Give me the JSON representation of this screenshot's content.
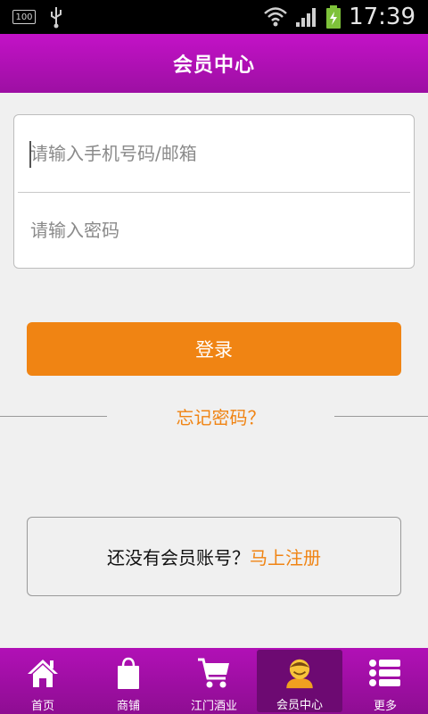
{
  "status_bar": {
    "battery_small_label": "100",
    "time": "17:39"
  },
  "header": {
    "title": "会员中心"
  },
  "login_form": {
    "username_placeholder": "请输入手机号码/邮箱",
    "password_placeholder": "请输入密码",
    "login_label": "登录",
    "forgot_label": "忘记密码？"
  },
  "register": {
    "prompt": "还没有会员账号？",
    "link": "马上注册"
  },
  "bottom_nav": {
    "items": [
      {
        "label": "首页",
        "icon": "home-icon"
      },
      {
        "label": "商铺",
        "icon": "shopping-bag-icon"
      },
      {
        "label": "江门酒业",
        "icon": "cart-icon"
      },
      {
        "label": "会员中心",
        "icon": "member-icon",
        "active": true
      },
      {
        "label": "更多",
        "icon": "more-list-icon"
      }
    ]
  },
  "colors": {
    "brand_purple": "#b110b6",
    "accent_orange": "#f08413"
  }
}
